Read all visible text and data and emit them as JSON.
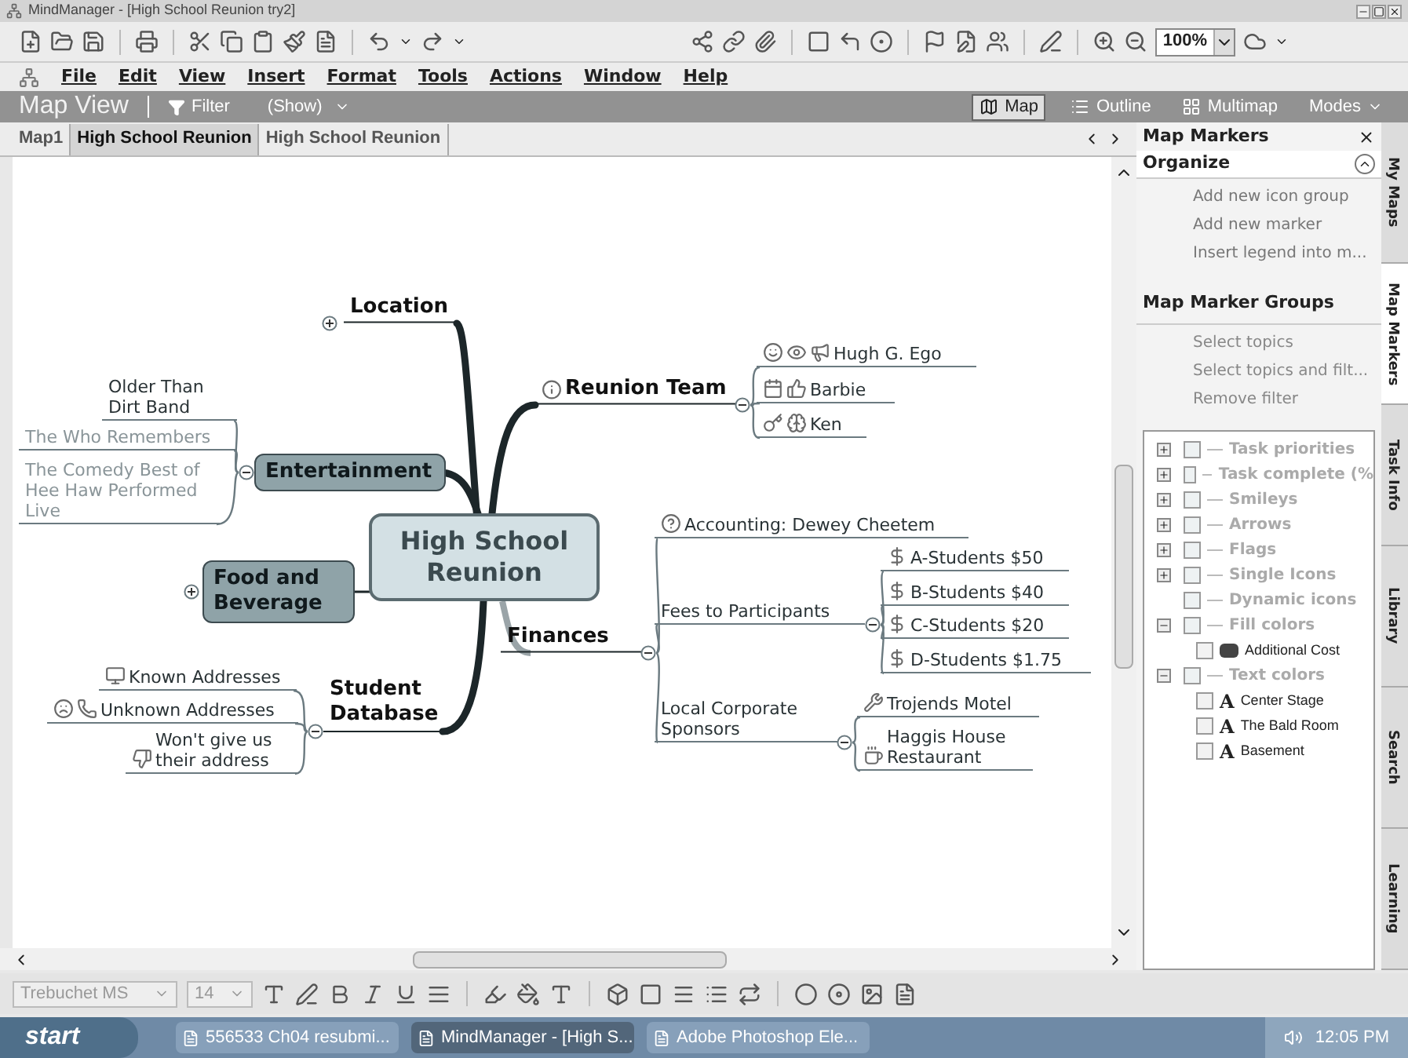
{
  "window": {
    "title": "MindManager - [High School Reunion try2]"
  },
  "toolbar": {
    "zoom": "100%"
  },
  "menu": [
    {
      "label": "File"
    },
    {
      "label": "Edit"
    },
    {
      "label": "View"
    },
    {
      "label": "Insert"
    },
    {
      "label": "Format"
    },
    {
      "label": "Tools"
    },
    {
      "label": "Actions"
    },
    {
      "label": "Window"
    },
    {
      "label": "Help"
    }
  ],
  "view_bar": {
    "title": "Map View",
    "filter": "Filter",
    "show": "(Show)",
    "modes": [
      {
        "label": "Map",
        "selected": true
      },
      {
        "label": "Outline",
        "selected": false
      },
      {
        "label": "Multimap",
        "selected": false
      },
      {
        "label": "Modes",
        "selected": false
      }
    ]
  },
  "tabs": [
    {
      "label": "Map1",
      "selected": false
    },
    {
      "label": "High School Reunion",
      "selected": true
    },
    {
      "label": "High School Reunion",
      "selected": false
    }
  ],
  "map": {
    "central": "High School Reunion",
    "topics": [
      {
        "label": "Location",
        "expanded": false
      },
      {
        "label": "Reunion Team",
        "expanded": true,
        "children": [
          {
            "label": "Hugh G. Ego"
          },
          {
            "label": "Barbie"
          },
          {
            "label": "Ken"
          }
        ]
      },
      {
        "label": "Entertainment",
        "expanded": true,
        "children": [
          {
            "label": "Older Than Dirt Band",
            "muted": false
          },
          {
            "label": "The Who Remembers",
            "muted": true
          },
          {
            "label": "The Comedy Best of Hee Haw Performed Live",
            "muted": true
          }
        ]
      },
      {
        "label": "Food and Beverage",
        "expanded": false
      },
      {
        "label": "Student Database",
        "expanded": true,
        "children": [
          {
            "label": "Known Addresses"
          },
          {
            "label": "Unknown Addresses"
          },
          {
            "label": "Won't give us their address"
          }
        ]
      },
      {
        "label": "Finances",
        "expanded": true,
        "children": [
          {
            "label": "Accounting: Dewey Cheetem"
          },
          {
            "label": "Fees to Participants",
            "expanded": true,
            "children": [
              {
                "label": "A-Students $50"
              },
              {
                "label": "B-Students $40"
              },
              {
                "label": "C-Students $20"
              },
              {
                "label": "D-Students $1.75"
              }
            ]
          },
          {
            "label": "Local Corporate Sponsors",
            "expanded": true,
            "children": [
              {
                "label": "Trojends Motel"
              },
              {
                "label": "Haggis House Restaurant"
              }
            ]
          }
        ]
      }
    ]
  },
  "panel": {
    "title": "Map Markers",
    "organize": {
      "title": "Organize",
      "expanded": true,
      "links": [
        "Add new icon group",
        "Add new marker",
        "Insert legend into m..."
      ]
    },
    "groups_title": "Map Marker Groups",
    "group_links": [
      "Select topics",
      "Select topics and filt...",
      "Remove filter"
    ],
    "tree": [
      {
        "label": "Task priorities",
        "expanded": false,
        "checked": false
      },
      {
        "label": "Task complete (%",
        "expanded": false,
        "checked": false
      },
      {
        "label": "Smileys",
        "expanded": false,
        "checked": false
      },
      {
        "label": "Arrows",
        "expanded": false,
        "checked": false
      },
      {
        "label": "Flags",
        "expanded": false,
        "checked": false
      },
      {
        "label": "Single Icons",
        "expanded": false,
        "checked": false
      },
      {
        "label": "Dynamic icons",
        "checked": false
      },
      {
        "label": "Fill colors",
        "expanded": true,
        "checked": false,
        "children": [
          {
            "kind": "fill",
            "label": "Additional Cost",
            "checked": false
          }
        ]
      },
      {
        "label": "Text colors",
        "expanded": true,
        "checked": false,
        "children": [
          {
            "kind": "text",
            "glyph": "A",
            "label": "Center Stage",
            "checked": false
          },
          {
            "kind": "text",
            "glyph": "A",
            "label": "The Bald Room",
            "checked": false
          },
          {
            "kind": "text",
            "glyph": "A",
            "label": "Basement",
            "checked": false
          }
        ]
      }
    ]
  },
  "side_tabs": [
    {
      "label": "My Maps",
      "selected": false
    },
    {
      "label": "Map Markers",
      "selected": true
    },
    {
      "label": "Task Info",
      "selected": false
    },
    {
      "label": "Library",
      "selected": false
    },
    {
      "label": "Search",
      "selected": false
    },
    {
      "label": "Learning",
      "selected": false
    }
  ],
  "format_bar": {
    "font": "Trebuchet MS",
    "size": "14"
  },
  "taskbar": {
    "start": "start",
    "tasks": [
      {
        "label": "556533 Ch04 resubmi...",
        "selected": false
      },
      {
        "label": "MindManager - [High S...",
        "selected": true
      },
      {
        "label": "Adobe Photoshop Ele...",
        "selected": false
      }
    ],
    "clock": "12:05 PM"
  }
}
